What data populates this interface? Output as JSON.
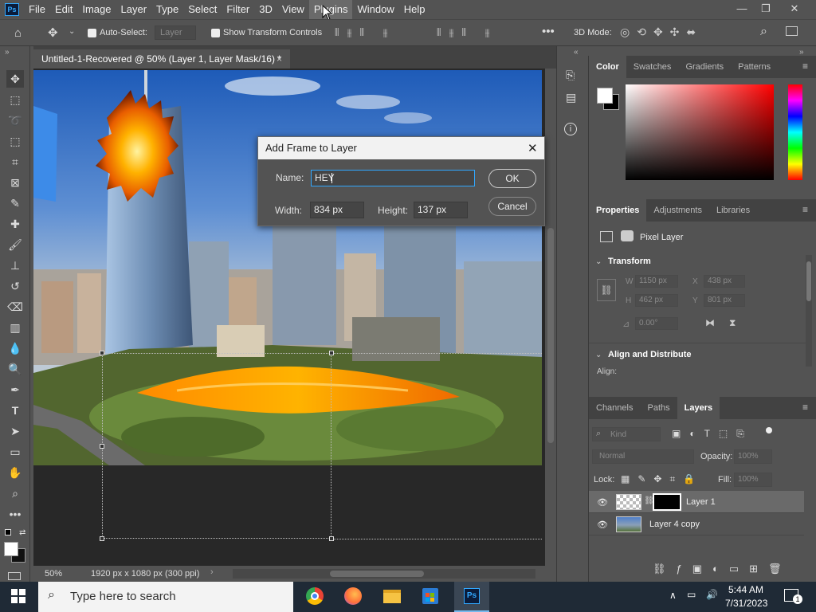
{
  "menu": {
    "items": [
      "File",
      "Edit",
      "Image",
      "Layer",
      "Type",
      "Select",
      "Filter",
      "3D",
      "View",
      "Plugins",
      "Window",
      "Help"
    ],
    "active": "Plugins"
  },
  "options_bar": {
    "auto_select_label": "Auto-Select:",
    "layer_dropdown": "Layer",
    "show_transform_label": "Show Transform Controls",
    "mode_3d_label": "3D Mode:"
  },
  "document": {
    "tab_title": "Untitled-1-Recovered @ 50% (Layer 1, Layer Mask/16) *"
  },
  "status": {
    "zoom": "50%",
    "doc_info": "1920 px x 1080 px (300 ppi)"
  },
  "dialog": {
    "title": "Add Frame to Layer",
    "name_label": "Name:",
    "name_value": "HEY",
    "width_label": "Width:",
    "width_value": "834 px",
    "height_label": "Height:",
    "height_value": "137 px",
    "ok": "OK",
    "cancel": "Cancel"
  },
  "color_panel": {
    "tabs": [
      "Color",
      "Swatches",
      "Gradients",
      "Patterns"
    ],
    "active": "Color"
  },
  "properties_panel": {
    "tabs": [
      "Properties",
      "Adjustments",
      "Libraries"
    ],
    "active": "Properties",
    "type_label": "Pixel Layer",
    "transform_label": "Transform",
    "w_label": "W",
    "w_value": "1150 px",
    "h_label": "H",
    "h_value": "462 px",
    "x_label": "X",
    "x_value": "438 px",
    "y_label": "Y",
    "y_value": "801 px",
    "angle_value": "0.00°",
    "align_label": "Align and Distribute",
    "align_sub": "Align:"
  },
  "layers_panel": {
    "tabs": [
      "Channels",
      "Paths",
      "Layers"
    ],
    "active": "Layers",
    "kind_placeholder": "Kind",
    "blend_mode": "Normal",
    "opacity_label": "Opacity:",
    "opacity_value": "100%",
    "lock_label": "Lock:",
    "fill_label": "Fill:",
    "fill_value": "100%",
    "layers": [
      {
        "name": "Layer 1"
      },
      {
        "name": "Layer 4 copy"
      }
    ]
  },
  "taskbar": {
    "search_placeholder": "Type here to search",
    "time": "5:44 AM",
    "date": "7/31/2023"
  },
  "colors": {
    "accent": "#31a8ff",
    "panel": "#535353",
    "dark_panel": "#424242",
    "taskbar": "#1f2a36"
  }
}
